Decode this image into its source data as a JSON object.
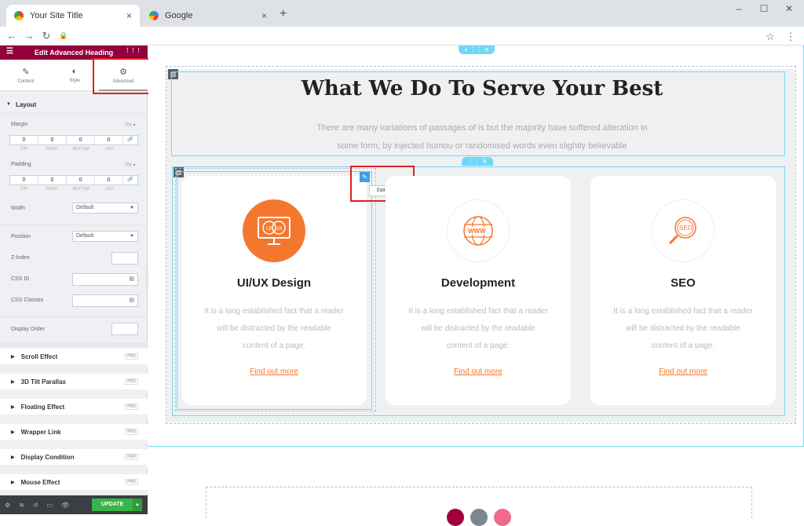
{
  "browser": {
    "tabs": [
      {
        "title": "Your Site Title",
        "close": "×"
      },
      {
        "title": "Google",
        "close": "×"
      }
    ],
    "new_tab": "+",
    "window_controls": {
      "minimize": "–",
      "maximize": "☐",
      "close": "✕"
    },
    "nav": {
      "back": "←",
      "forward": "→",
      "reload": "↻",
      "lock": "🔒",
      "star": "☆",
      "menu": "⋮"
    }
  },
  "panel": {
    "header_title": "Edit Advanced Heading",
    "hamburger": "☰",
    "grid": "⋮⋮⋮",
    "tabs": [
      {
        "label": "Content",
        "icon": "✎"
      },
      {
        "label": "Style",
        "icon": "◐"
      },
      {
        "label": "Advanced",
        "icon": "⚙"
      }
    ],
    "layout_section": "Layout",
    "margin_label": "Margin",
    "padding_label": "Padding",
    "unit": "PX ▾",
    "box_values": [
      "0",
      "0",
      "0",
      "0"
    ],
    "box_sub": [
      "TOP",
      "RIGHT",
      "BOTTOM",
      "LEFT"
    ],
    "link_icon": "🔗",
    "width_label": "Width",
    "width_value": "Default",
    "position_label": "Position",
    "position_value": "Default",
    "zindex_label": "Z-Index",
    "cssid_label": "CSS ID",
    "cssclasses_label": "CSS Classes",
    "display_order_label": "Display Order",
    "pro_badge": "PRO",
    "accordions": [
      "Scroll Effect",
      "3D Tilt Parallax",
      "Floating Effect",
      "Wrapper Link",
      "Display Condition",
      "Mouse Effect"
    ],
    "update_label": "UPDATE",
    "footer_icons": [
      "⚙",
      "≋",
      "↺",
      "▭",
      "👁"
    ]
  },
  "canvas": {
    "heading": "What We Do To Serve Your Best",
    "subtext_line1": "There are many variations of passages of is but the majority have suffered alteration in",
    "subtext_line2": "some form, by injected humou or randomised words even slightly believable",
    "edit_tooltip": "Edit Info Box",
    "cards": [
      {
        "title": "UI/UX Design",
        "body": "It is a long established fact that a reader will be distracted by the readable content of a page.",
        "link": "Find out more",
        "icon": "ui-ux-icon"
      },
      {
        "title": "Development",
        "body": "It is a long established fact that a reader will be distracted by the readable content of a page.",
        "link": "Find out more",
        "icon": "www-globe-icon"
      },
      {
        "title": "SEO",
        "body": "It is a long established fact that a reader will be distracted by the readable content of a page.",
        "link": "Find out more",
        "icon": "seo-magnifier-icon"
      }
    ],
    "handle_section": "+ ⋮⋮ ✕",
    "handle_inner": "⋮⋮ ✕"
  },
  "colors": {
    "accent": "#93003c",
    "orange": "#f4772e",
    "blue": "#71d7f7",
    "update": "#39b54a"
  }
}
